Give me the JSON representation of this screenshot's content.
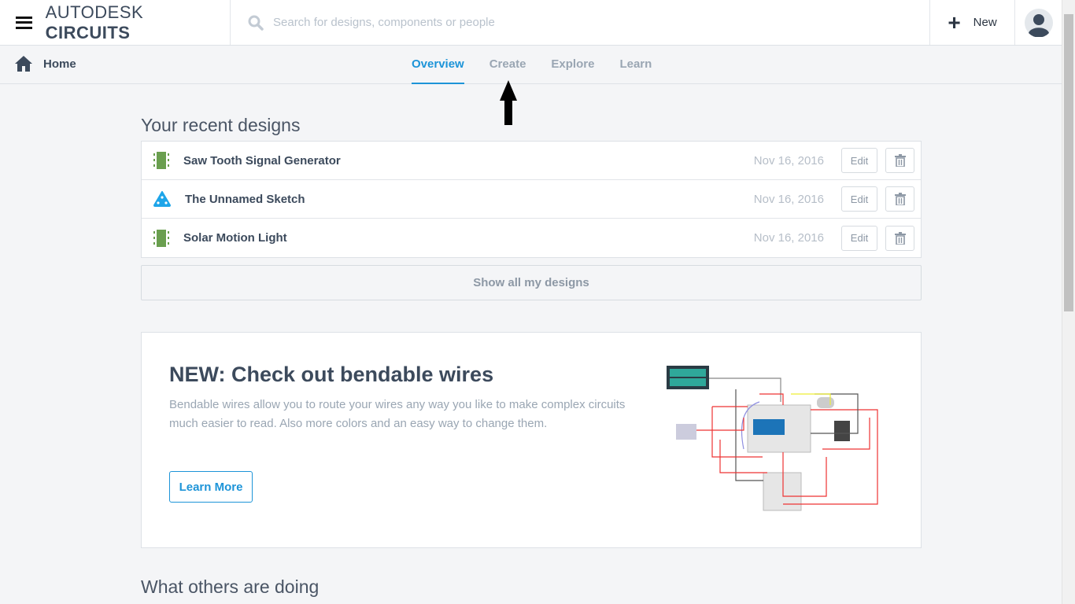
{
  "header": {
    "brand_light": "AUTODESK",
    "brand_bold": "CIRCUITS",
    "search_placeholder": "Search for designs, components or people",
    "new_label": "New"
  },
  "subnav": {
    "home": "Home",
    "tabs": [
      {
        "label": "Overview",
        "active": true
      },
      {
        "label": "Create"
      },
      {
        "label": "Explore"
      },
      {
        "label": "Learn"
      }
    ]
  },
  "recent": {
    "title": "Your recent designs",
    "items": [
      {
        "name": "Saw Tooth Signal Generator",
        "date": "Nov 16, 2016",
        "icon": "breadboard-icon"
      },
      {
        "name": "The Unnamed Sketch",
        "date": "Nov 16, 2016",
        "icon": "sketch-triangle-icon"
      },
      {
        "name": "Solar Motion Light",
        "date": "Nov 16, 2016",
        "icon": "breadboard-icon"
      }
    ],
    "edit_label": "Edit",
    "show_all": "Show all my designs"
  },
  "promo": {
    "title": "NEW: Check out bendable wires",
    "body": "Bendable wires allow you to route your wires any way you like to make complex circuits much easier to read. Also more colors and an easy way to change them.",
    "button": "Learn More"
  },
  "others": {
    "title": "What others are doing"
  },
  "colors": {
    "accent": "#1d94d8",
    "breadboard": "#6a9f4f",
    "sketch": "#1ea5e9"
  }
}
